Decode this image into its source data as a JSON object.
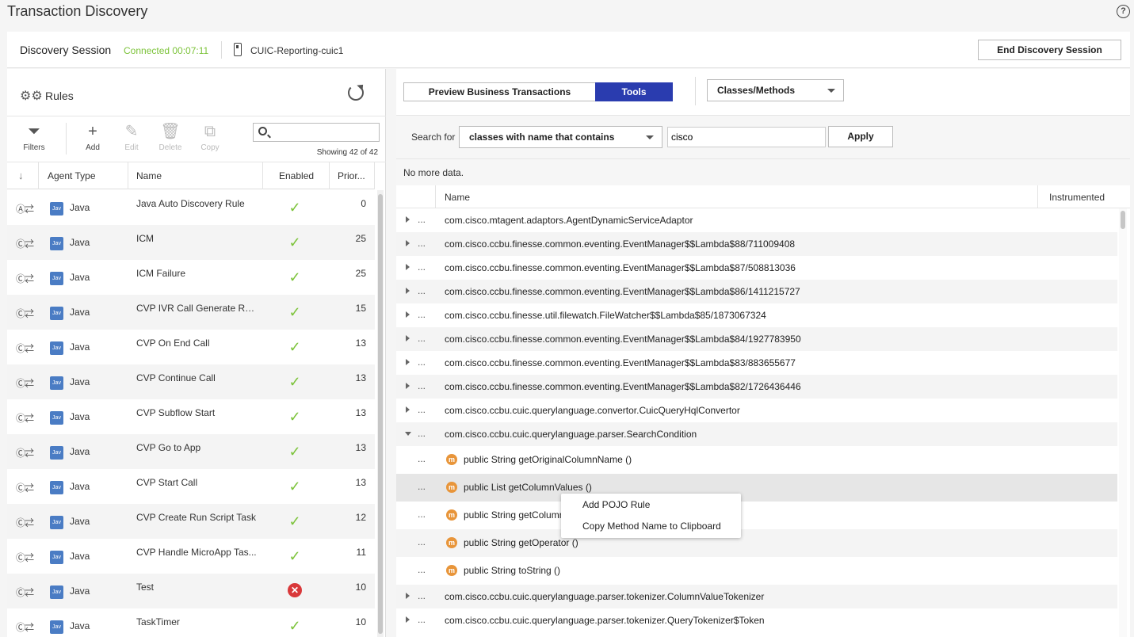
{
  "app": {
    "title": "Transaction Discovery",
    "help_icon": "?"
  },
  "session": {
    "title": "Discovery Session",
    "status": "Connected 00:07:11",
    "node": "CUIC-Reporting-cuic1",
    "end_button": "End Discovery Session",
    "status_color": "#7cc33a"
  },
  "rules": {
    "title": "Rules",
    "toolbar": {
      "filters": "Filters",
      "add": "Add",
      "edit": "Edit",
      "delete": "Delete",
      "copy": "Copy",
      "search_value": "",
      "showing": "Showing 42 of 42"
    },
    "columns": {
      "agent_type": "Agent Type",
      "name": "Name",
      "enabled": "Enabled",
      "priority": "Prior..."
    },
    "rows": [
      {
        "type_glyph": "Ⓐ⇄",
        "badge": "Jav",
        "agent": "Java",
        "name": "Java Auto Discovery Rule",
        "enabled": true,
        "priority": "0"
      },
      {
        "type_glyph": "Ⓒ⇄",
        "badge": "Jav",
        "agent": "Java",
        "name": "ICM",
        "enabled": true,
        "priority": "25"
      },
      {
        "type_glyph": "Ⓒ⇄",
        "badge": "Jav",
        "agent": "Java",
        "name": "ICM Failure",
        "enabled": true,
        "priority": "25"
      },
      {
        "type_glyph": "Ⓒ⇄",
        "badge": "Jav",
        "agent": "Java",
        "name": "CVP IVR Call Generate Res...",
        "enabled": true,
        "priority": "15"
      },
      {
        "type_glyph": "Ⓒ⇄",
        "badge": "Jav",
        "agent": "Java",
        "name": "CVP On End Call",
        "enabled": true,
        "priority": "13"
      },
      {
        "type_glyph": "Ⓒ⇄",
        "badge": "Jav",
        "agent": "Java",
        "name": "CVP Continue Call",
        "enabled": true,
        "priority": "13"
      },
      {
        "type_glyph": "Ⓒ⇄",
        "badge": "Jav",
        "agent": "Java",
        "name": "CVP Subflow Start",
        "enabled": true,
        "priority": "13"
      },
      {
        "type_glyph": "Ⓒ⇄",
        "badge": "Jav",
        "agent": "Java",
        "name": "CVP Go to App",
        "enabled": true,
        "priority": "13"
      },
      {
        "type_glyph": "Ⓒ⇄",
        "badge": "Jav",
        "agent": "Java",
        "name": "CVP Start Call",
        "enabled": true,
        "priority": "13"
      },
      {
        "type_glyph": "Ⓒ⇄",
        "badge": "Jav",
        "agent": "Java",
        "name": "CVP Create Run Script Task",
        "enabled": true,
        "priority": "12"
      },
      {
        "type_glyph": "Ⓒ⇄",
        "badge": "Jav",
        "agent": "Java",
        "name": "CVP Handle MicroApp Tas...",
        "enabled": true,
        "priority": "11"
      },
      {
        "type_glyph": "Ⓒ⇄",
        "badge": "Jav",
        "agent": "Java",
        "name": "Test",
        "enabled": false,
        "priority": "10"
      },
      {
        "type_glyph": "Ⓒ⇄",
        "badge": "Jav",
        "agent": "Java",
        "name": "TaskTimer",
        "enabled": true,
        "priority": "10"
      }
    ]
  },
  "tools": {
    "tabs": {
      "preview": "Preview Business Transactions",
      "tools": "Tools"
    },
    "view_select": "Classes/Methods",
    "search_for_label": "Search for",
    "search_for_select": "classes with name that contains",
    "search_text": "cisco",
    "apply": "Apply",
    "no_more": "No more data.",
    "columns": {
      "name": "Name",
      "instrumented": "Instrumented"
    },
    "items": [
      {
        "kind": "class",
        "expanded": false,
        "label": "com.cisco.mtagent.adaptors.AgentDynamicServiceAdaptor"
      },
      {
        "kind": "class",
        "expanded": false,
        "label": "com.cisco.ccbu.finesse.common.eventing.EventManager$$Lambda$88/711009408"
      },
      {
        "kind": "class",
        "expanded": false,
        "label": "com.cisco.ccbu.finesse.common.eventing.EventManager$$Lambda$87/508813036"
      },
      {
        "kind": "class",
        "expanded": false,
        "label": "com.cisco.ccbu.finesse.common.eventing.EventManager$$Lambda$86/1411215727"
      },
      {
        "kind": "class",
        "expanded": false,
        "label": "com.cisco.ccbu.finesse.util.filewatch.FileWatcher$$Lambda$85/1873067324"
      },
      {
        "kind": "class",
        "expanded": false,
        "label": "com.cisco.ccbu.finesse.common.eventing.EventManager$$Lambda$84/1927783950"
      },
      {
        "kind": "class",
        "expanded": false,
        "label": "com.cisco.ccbu.finesse.common.eventing.EventManager$$Lambda$83/883655677"
      },
      {
        "kind": "class",
        "expanded": false,
        "label": "com.cisco.ccbu.finesse.common.eventing.EventManager$$Lambda$82/1726436446"
      },
      {
        "kind": "class",
        "expanded": false,
        "label": "com.cisco.ccbu.cuic.querylanguage.convertor.CuicQueryHqlConvertor"
      },
      {
        "kind": "class",
        "expanded": true,
        "label": "com.cisco.ccbu.cuic.querylanguage.parser.SearchCondition"
      },
      {
        "kind": "method",
        "label": "public String getOriginalColumnName ()"
      },
      {
        "kind": "method",
        "selected": true,
        "label": "public List getColumnValues ()"
      },
      {
        "kind": "method",
        "label": "public String getColumnName ()"
      },
      {
        "kind": "method",
        "label": "public String getOperator ()"
      },
      {
        "kind": "method",
        "label": "public String toString ()"
      },
      {
        "kind": "class",
        "expanded": false,
        "label": "com.cisco.ccbu.cuic.querylanguage.parser.tokenizer.ColumnValueTokenizer"
      },
      {
        "kind": "class",
        "expanded": false,
        "label": "com.cisco.ccbu.cuic.querylanguage.parser.tokenizer.QueryTokenizer$Token"
      }
    ],
    "context_menu": [
      "Add POJO Rule",
      "Copy Method Name to Clipboard"
    ]
  },
  "colors": {
    "accent": "#2a3caf",
    "success": "#7cc33a",
    "error": "#d9383a",
    "method_badge": "#e8953a",
    "java_badge": "#4a7cc4"
  }
}
